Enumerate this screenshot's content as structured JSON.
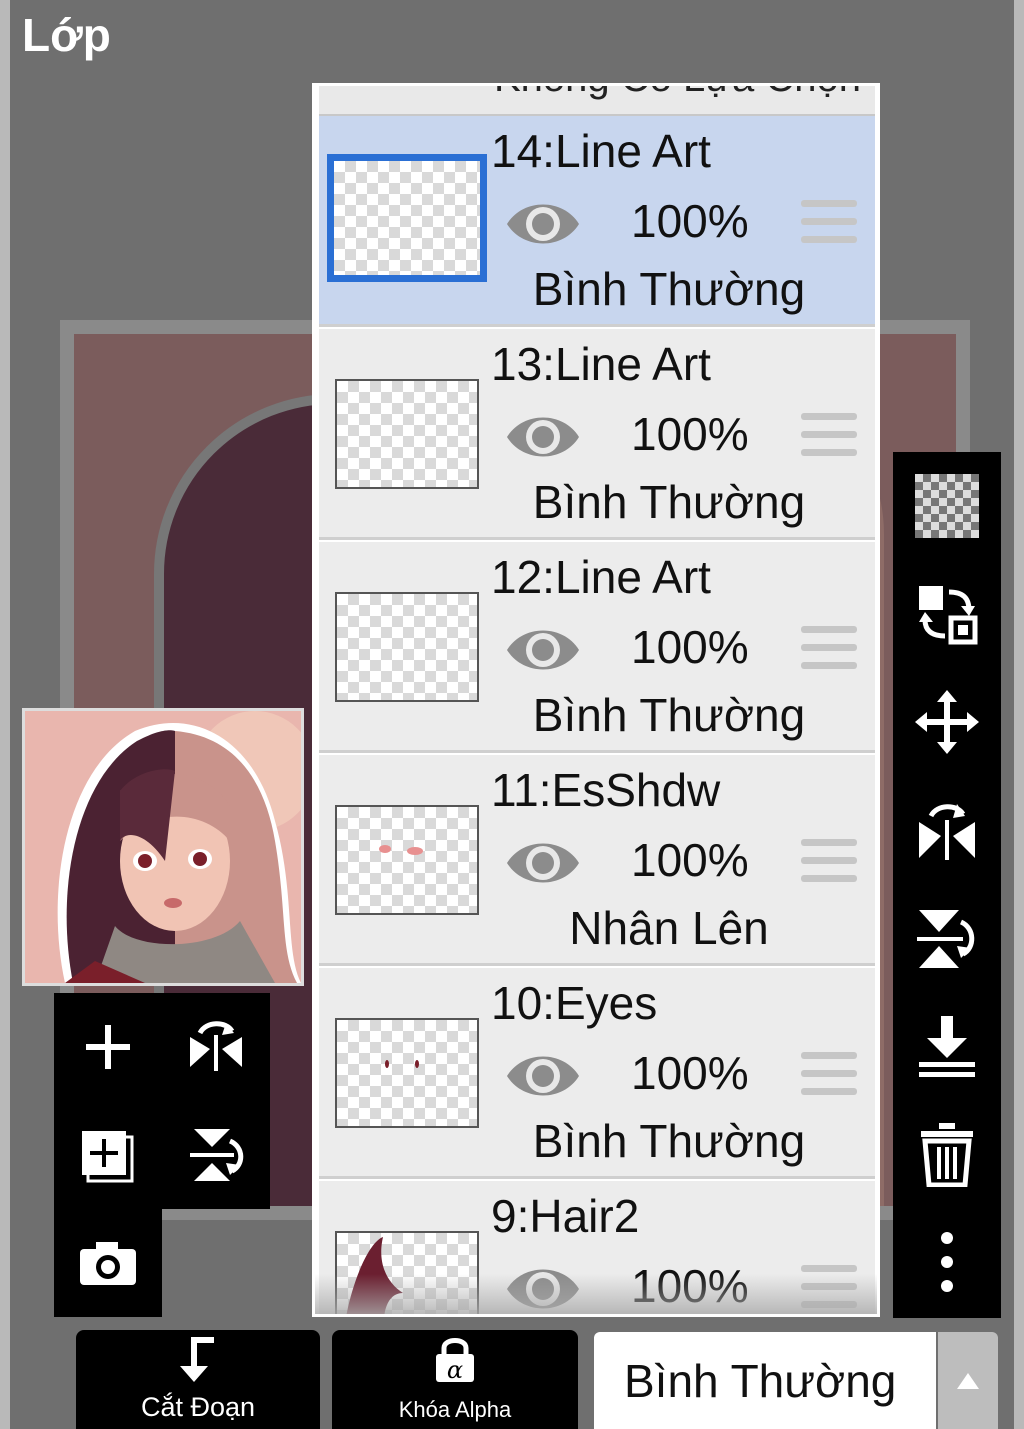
{
  "app": {
    "title": "Lớp"
  },
  "panel": {
    "top_cut_text": "Không Có Lựa Chọn",
    "layers": [
      {
        "name": "14:Line Art",
        "opacity": "100%",
        "mode": "Bình Thường",
        "selected": true
      },
      {
        "name": "13:Line Art",
        "opacity": "100%",
        "mode": "Bình Thường",
        "selected": false
      },
      {
        "name": "12:Line Art",
        "opacity": "100%",
        "mode": "Bình Thường",
        "selected": false
      },
      {
        "name": "11:EsShdw",
        "opacity": "100%",
        "mode": "Nhân Lên",
        "selected": false
      },
      {
        "name": "10:Eyes",
        "opacity": "100%",
        "mode": "Bình Thường",
        "selected": false
      },
      {
        "name": "9:Hair2",
        "opacity": "100%",
        "mode": "",
        "selected": false
      }
    ]
  },
  "left_toolbar": [
    "add-layer-icon",
    "flip-horizontal-icon",
    "add-layer-copy-icon",
    "flip-vertical-icon",
    "camera-icon"
  ],
  "right_toolbar": [
    "transparency-icon",
    "swap-icon",
    "move-icon",
    "rotate-flip-h-icon",
    "rotate-flip-v-icon",
    "merge-down-icon",
    "trash-icon",
    "more-icon"
  ],
  "bottom": {
    "clip_label": "Cắt Đoạn",
    "alpha_lock_label": "Khóa Alpha",
    "blend_mode": "Bình Thường"
  },
  "colors": {
    "selected_layer": "#c8d6ee",
    "selection_border": "#2a6fd4",
    "toolbar": "#000000"
  }
}
